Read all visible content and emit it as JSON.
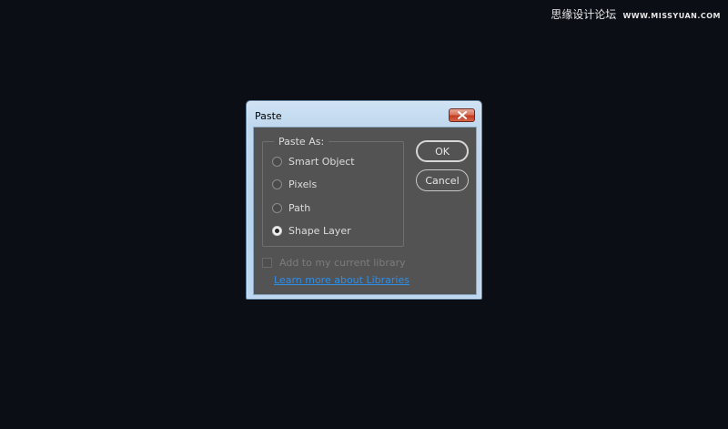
{
  "watermark": {
    "text_cn": "思缘设计论坛",
    "url": "WWW.MISSYUAN.COM"
  },
  "dialog": {
    "title": "Paste",
    "close_icon": "close-x-icon",
    "group_label": "Paste As:",
    "options": [
      {
        "label": "Smart Object",
        "checked": false
      },
      {
        "label": "Pixels",
        "checked": false
      },
      {
        "label": "Path",
        "checked": false
      },
      {
        "label": "Shape Layer",
        "checked": true
      }
    ],
    "ok_label": "OK",
    "cancel_label": "Cancel",
    "library_checkbox_label": "Add to my current library",
    "library_checkbox_checked": false,
    "library_checkbox_disabled": true,
    "learn_more_link": "Learn more about Libraries"
  },
  "colors": {
    "desktop_bg": "#0c0e16",
    "panel_bg": "#535353",
    "link": "#2f8ee6",
    "close_button": "#c23d20"
  }
}
